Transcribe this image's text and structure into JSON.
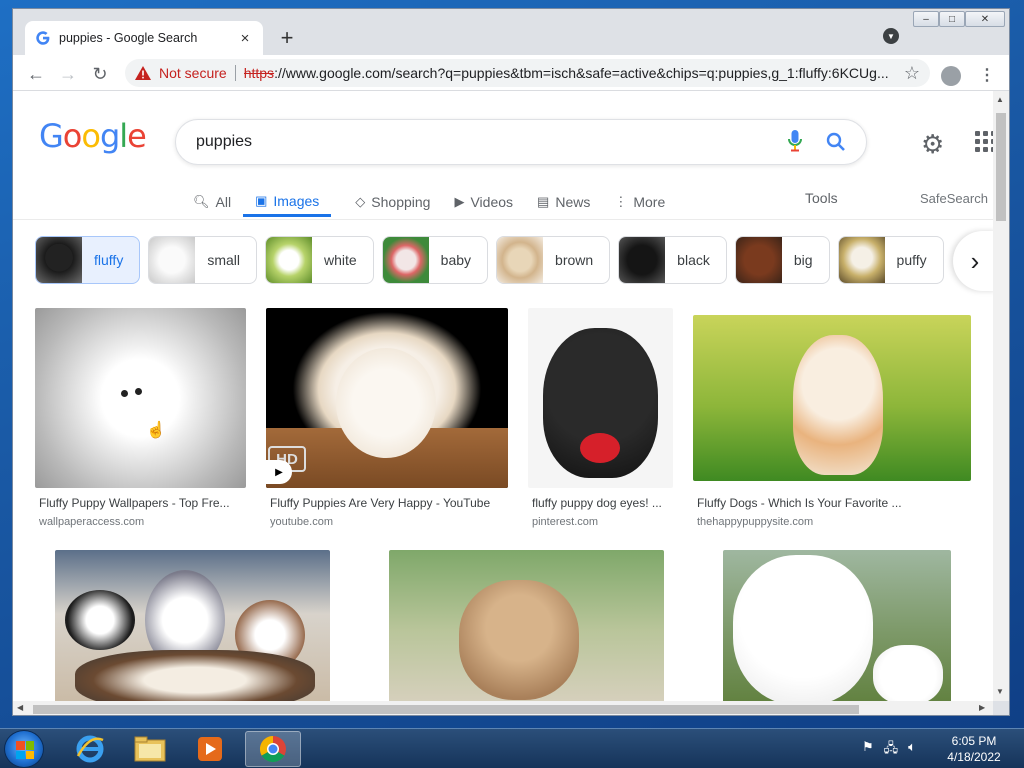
{
  "browser": {
    "tab_title": "puppies - Google Search",
    "tab_close": "×",
    "new_tab": "+",
    "not_secure": "Not secure",
    "url_scheme": "https",
    "url_rest": "://www.google.com/search?q=puppies&tbm=isch&safe=active&chips=q:puppies,g_1:fluffy:6KCUg...",
    "window_min": "–",
    "window_max": "□",
    "window_close": "✕"
  },
  "google": {
    "logo_letters": [
      "G",
      "o",
      "o",
      "g",
      "l",
      "e"
    ],
    "logo_colors": [
      "#4285F4",
      "#EA4335",
      "#FBBC05",
      "#4285F4",
      "#34A853",
      "#EA4335"
    ],
    "query": "puppies",
    "tabs": [
      {
        "label": "All",
        "icon": "search-icon"
      },
      {
        "label": "Images",
        "icon": "image-icon"
      },
      {
        "label": "Shopping",
        "icon": "tag-icon"
      },
      {
        "label": "Videos",
        "icon": "play-icon"
      },
      {
        "label": "News",
        "icon": "news-icon"
      },
      {
        "label": "More",
        "icon": "more-icon"
      }
    ],
    "tools": "Tools",
    "safesearch": "SafeSearch"
  },
  "chips": [
    {
      "label": "fluffy",
      "selected": true
    },
    {
      "label": "small"
    },
    {
      "label": "white"
    },
    {
      "label": "baby"
    },
    {
      "label": "brown"
    },
    {
      "label": "black"
    },
    {
      "label": "big"
    },
    {
      "label": "puffy"
    }
  ],
  "results": [
    {
      "caption": "Fluffy Puppy Wallpapers - Top Fre...",
      "source": "wallpaperaccess.com"
    },
    {
      "caption": "Fluffy Puppies Are Very Happy - YouTube",
      "source": "youtube.com",
      "badge": "HD"
    },
    {
      "caption": "fluffy puppy dog eyes! ...",
      "source": "pinterest.com"
    },
    {
      "caption": "Fluffy Dogs - Which Is Your Favorite ...",
      "source": "thehappypuppysite.com"
    }
  ],
  "taskbar": {
    "time": "6:05 PM",
    "date": "4/18/2022"
  }
}
